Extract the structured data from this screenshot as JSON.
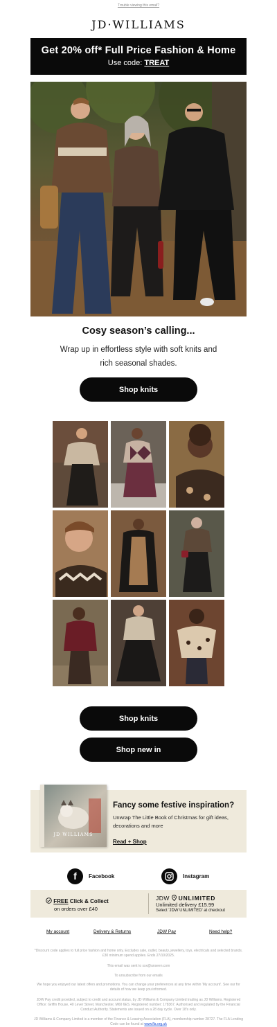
{
  "header": {
    "trouble_link": "Trouble viewing this email?",
    "brand": "JD·WILLIAMS"
  },
  "promo": {
    "headline": "Get 20% off* Full Price Fashion & Home",
    "code_prefix": "Use code:",
    "code": "TREAT"
  },
  "hero": {
    "headline": "Cosy season’s calling...",
    "subtext": "Wrap up in effortless style with soft knits and rich seasonal shades.",
    "cta": "Shop knits"
  },
  "grid": {
    "tiles": [
      {
        "label": "Model in oversized beige knit and black maxi skirt",
        "bg": "#5e4a3a"
      },
      {
        "label": "Model in argyle knit and burgundy skirt",
        "bg": "#6b6258"
      },
      {
        "label": "Model in leopard cardigan close-up",
        "bg": "#8a6b44"
      },
      {
        "label": "Model in fair isle knit close-up",
        "bg": "#a07b58"
      },
      {
        "label": "Model in black coat and leopard dress",
        "bg": "#7b5a3e"
      },
      {
        "label": "Model in brown knit with red bag",
        "bg": "#59584a"
      },
      {
        "label": "Model in burgundy cardigan",
        "bg": "#7a6a52"
      },
      {
        "label": "Model in cream knit and black skirt",
        "bg": "#4e4036"
      },
      {
        "label": "Model in leopard wrap over shoulders",
        "bg": "#6d4530"
      }
    ]
  },
  "ctas": {
    "shop_knits": "Shop knits",
    "shop_new_in": "Shop new in"
  },
  "festive": {
    "book_title": "JD WILLIAMS",
    "title": "Fancy some festive inspiration?",
    "body": "Unwrap The Little Book of Christmas for gift ideas, decorations and more",
    "link": "Read + Shop"
  },
  "social": {
    "facebook": "Facebook",
    "instagram": "Instagram"
  },
  "delivery": {
    "free_word": "FREE",
    "click_collect": "Click & Collect",
    "click_collect_sub": "on orders over £40",
    "jdw": "JDW",
    "unlimited": "UNLIMITED",
    "unlimited_line": "Unlimited delivery £15.99",
    "unlimited_note": "Select 'JDW UNLIMITED' at checkout"
  },
  "footer": {
    "links": [
      "My account",
      "Delivery & Returns",
      "JDW Pay",
      "Need help?"
    ],
    "legal_1": "*Discount code applies to full price fashion and home only. Excludes sale, outlet, beauty, jewellery, toys, electricals and selected brands. £30 minimum spend applies. Ends 27/10/2025.",
    "legal_2": "This email was sent to xxx@unseen.com",
    "legal_3": "To unsubscribe from our emails",
    "legal_4": "We hope you enjoyed our latest offers and promotions. You can change your preferences at any time within 'My account'. See our for details of how we keep you informed.",
    "legal_5": "JDW Pay credit provided, subject to credit and account status, by JD Williams & Company Limited trading as JD Williams. Registered Office: Griffin House, 40 Lever Street, Manchester, M60 6ES. Registered number: 178367. Authorised and regulated by the Financial Conduct Authority. Statements are issued on a 28 day cycle. Over 18's only.",
    "legal_6": "JD Williams & Company Limited is a member of the Finance & Leasing Association (FLA), membership number 28727. The FLA Lending Code can be found at",
    "legal_6_link": "www.fla.org.uk"
  },
  "colors": {
    "black": "#0a0a0a",
    "beige_panel": "#efeadc",
    "legal_grey": "#a0a0a0",
    "link_blue": "#1a4fd8"
  }
}
